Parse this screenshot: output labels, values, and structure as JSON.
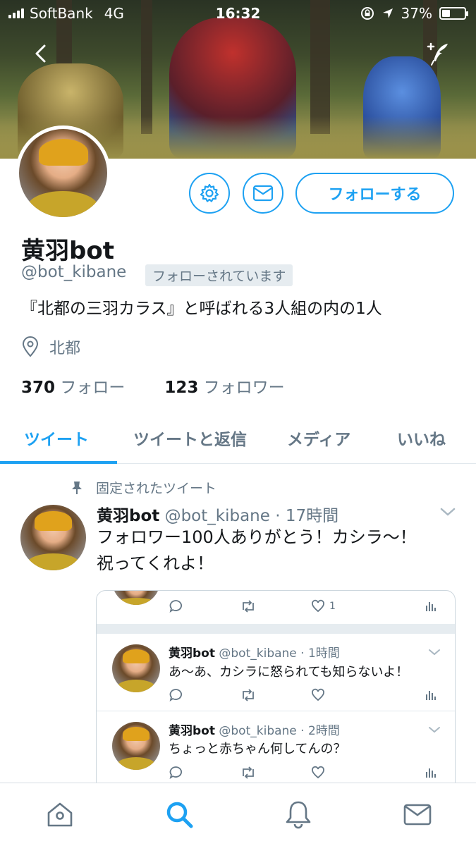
{
  "status_bar": {
    "carrier": "SoftBank",
    "network": "4G",
    "time": "16:32",
    "battery_percent": "37%",
    "battery_level": 0.37
  },
  "profile": {
    "name": "黄羽bot",
    "handle": "@bot_kibane",
    "follows_you_badge": "フォローされています",
    "bio": "『北都の三羽カラス』と呼ばれる3人組の内の1人",
    "location": "北都",
    "following_count": "370",
    "following_label": "フォロー",
    "followers_count": "123",
    "followers_label": "フォロワー",
    "follow_button": "フォローする"
  },
  "tabs": [
    {
      "label": "ツイート",
      "active": true
    },
    {
      "label": "ツイートと返信",
      "active": false
    },
    {
      "label": "メディア",
      "active": false
    },
    {
      "label": "いいね",
      "active": false
    }
  ],
  "pinned_tweet": {
    "pinned_label": "固定されたツイート",
    "author": "黄羽bot",
    "meta": "@bot_kibane · 17時間",
    "text_line1": "フォロワー100人ありがとう！カシラ〜！",
    "text_line2": "祝ってくれよ！",
    "like_count": "1"
  },
  "thread": [
    {
      "author": "黄羽bot",
      "meta": "@bot_kibane · 1時間",
      "text": "あ〜あ、カシラに怒られても知らないよ！"
    },
    {
      "author": "黄羽bot",
      "meta": "@bot_kibane · 2時間",
      "text": "ちょっと赤ちゃん何してんの？"
    }
  ],
  "colors": {
    "accent": "#1da1f2",
    "text_secondary": "#657786",
    "badge_bg": "#e6ecf0"
  },
  "icons": {
    "back": "chevron-left-icon",
    "compose": "compose-feather-icon",
    "settings": "gear-icon",
    "message": "envelope-icon",
    "location": "location-pin-icon",
    "pin": "pin-icon",
    "reply": "reply-icon",
    "retweet": "retweet-icon",
    "like": "heart-icon",
    "analytics": "analytics-icon",
    "nav": [
      "home-icon",
      "search-icon",
      "notifications-icon",
      "messages-icon"
    ]
  }
}
